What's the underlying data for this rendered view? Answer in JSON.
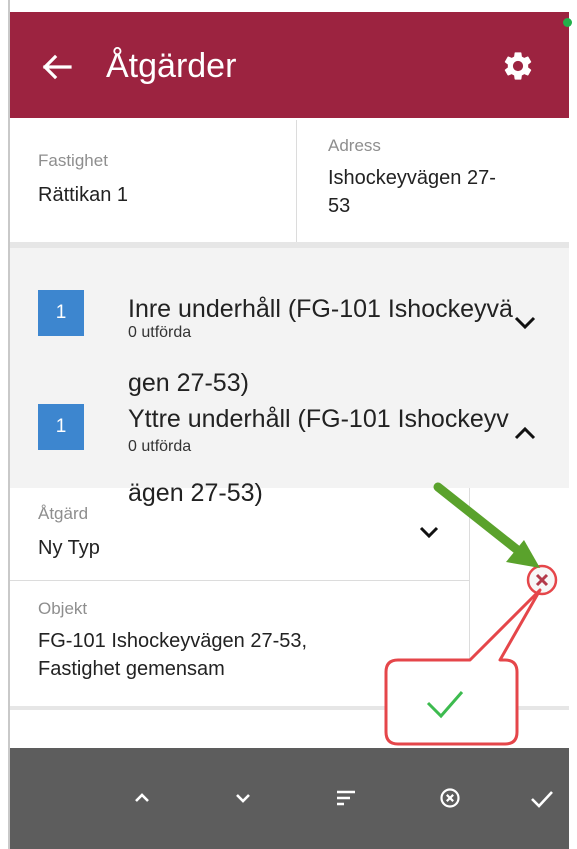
{
  "appbar": {
    "title": "Åtgärder",
    "back_icon": "arrow-left-icon",
    "settings_icon": "gear-icon",
    "color": "#9c2340"
  },
  "info": {
    "property_label": "Fastighet",
    "property_value": "Rättikan 1",
    "address_label": "Adress",
    "address_line1": "Ishockeyvägen 27-",
    "address_line2": "53"
  },
  "groups": [
    {
      "count": "1",
      "title": "Inre underhåll (FG-101 Ishockeyvä",
      "subtitle": "0 utförda",
      "expanded": false
    },
    {
      "count": "1",
      "title": "Yttre underhåll (FG-101 Ishockeyv",
      "subtitle": "0 utförda",
      "expanded": true
    }
  ],
  "overflow": {
    "line1": "gen 27-53)",
    "line2": "ägen 27-53)"
  },
  "detail": {
    "type_label": "Åtgärd",
    "type_value": "Ny Typ",
    "object_label": "Objekt",
    "object_line1": "FG-101 Ishockeyvägen 27-53,",
    "object_line2": "Fastighet gemensam"
  },
  "toolbar": {
    "items": [
      "chevron-up-icon",
      "chevron-down-icon",
      "sort-icon",
      "cancel-circle-icon",
      "check-icon"
    ]
  },
  "annotation": {
    "arrow_color": "#5aa22c",
    "callout_color": "#e5464a",
    "check_color": "#3dbb4f"
  }
}
